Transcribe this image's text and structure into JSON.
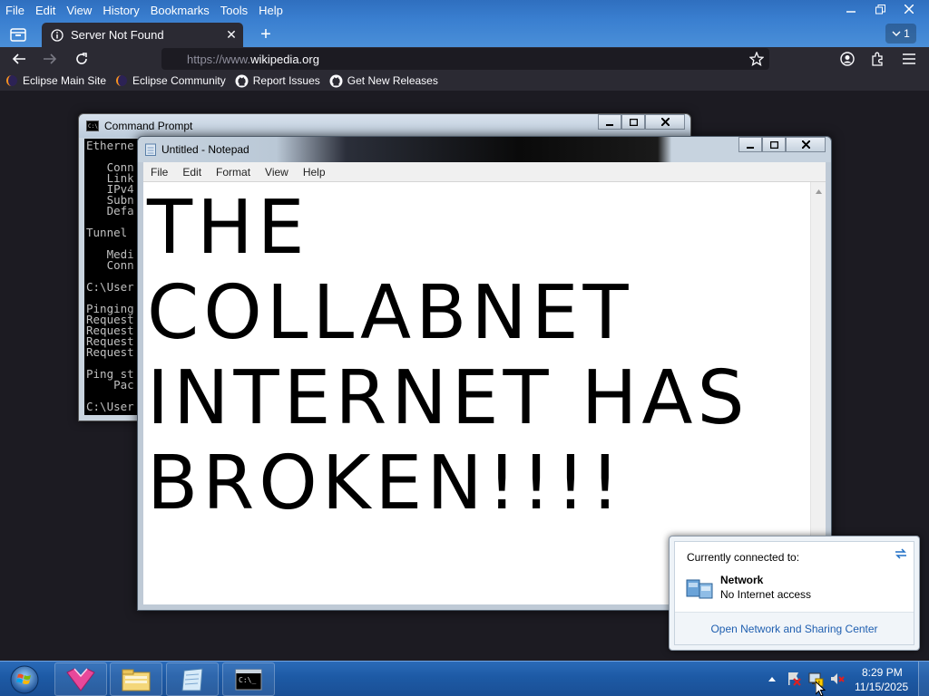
{
  "browser": {
    "menu": [
      "File",
      "Edit",
      "View",
      "History",
      "Bookmarks",
      "Tools",
      "Help"
    ],
    "window_controls": {
      "minimize": "—",
      "restore": "❐",
      "close": "✕"
    },
    "tab": {
      "title": "Server Not Found",
      "close": "✕"
    },
    "new_tab": "+",
    "tab_count": "1",
    "url": {
      "protocol": "https://www.",
      "host": "wikipedia.org"
    },
    "bookmarks": [
      {
        "label": "Eclipse Main Site",
        "icon": "eclipse-icon"
      },
      {
        "label": "Eclipse Community",
        "icon": "eclipse-icon"
      },
      {
        "label": "Report Issues",
        "icon": "github-icon"
      },
      {
        "label": "Get New Releases",
        "icon": "github-icon"
      }
    ]
  },
  "cmd": {
    "title": "Command Prompt",
    "lines": [
      "Etherne",
      "",
      "   Conn",
      "   Link",
      "   IPv4",
      "   Subn",
      "   Defa",
      "",
      "Tunnel ",
      "",
      "   Medi",
      "   Conn",
      "",
      "C:\\User",
      "",
      "Pinging",
      "Request",
      "Request",
      "Request",
      "Request",
      "",
      "Ping st",
      "    Pac",
      "",
      "C:\\User"
    ]
  },
  "notepad": {
    "title": "Untitled - Notepad",
    "menu": [
      "File",
      "Edit",
      "Format",
      "View",
      "Help"
    ],
    "text": "THE\nCOLLABNET\nINTERNET HAS\nBROKEN!!!!"
  },
  "network_popup": {
    "header": "Currently connected to:",
    "network_name": "Network",
    "network_status": "No Internet access",
    "link": "Open Network and Sharing Center"
  },
  "taskbar": {
    "time": "8:29 PM",
    "date": "11/15/2025",
    "apps": [
      "paint-app-icon",
      "file-explorer-icon",
      "notepad-icon",
      "command-prompt-icon"
    ],
    "tray": [
      "show-hidden-icons",
      "action-center-flag-icon",
      "network-no-internet-icon",
      "volume-muted-icon"
    ]
  },
  "colors": {
    "tab_bg": "#2b2a33",
    "urlbar_bg": "#1c1b22",
    "taskbar": "#1d5aa5",
    "link": "#1f5fb0"
  }
}
